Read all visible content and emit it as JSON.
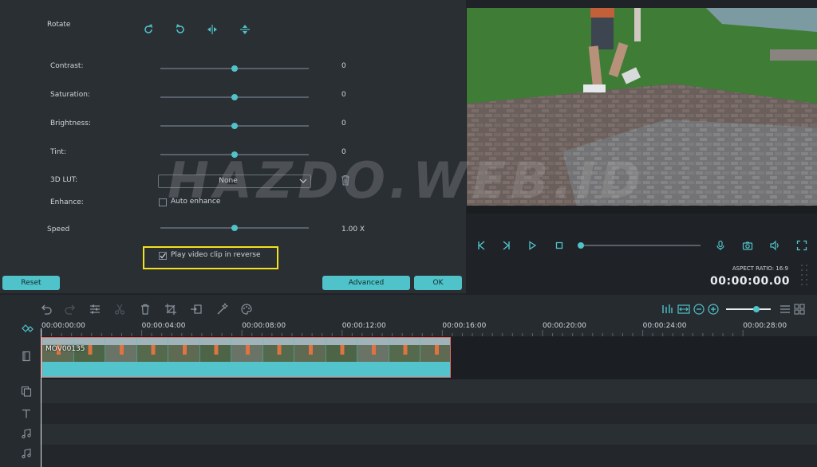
{
  "settings": {
    "rotate_label": "Rotate",
    "sliders": [
      {
        "label": "Contrast:",
        "value": "0",
        "level": 0.5
      },
      {
        "label": "Saturation:",
        "value": "0",
        "level": 0.5
      },
      {
        "label": "Brightness:",
        "value": "0",
        "level": 0.5
      },
      {
        "label": "Tint:",
        "value": "0",
        "level": 0.5
      }
    ],
    "lut_label": "3D LUT:",
    "lut_value": "None",
    "enhance_label": "Enhance:",
    "auto_enhance_label": "Auto enhance",
    "speed_label": "Speed",
    "speed_value": "1.00 X",
    "speed_level": 0.5,
    "reverse_label": "Play video clip in reverse",
    "reverse_checked": true,
    "reset_label": "Reset",
    "advanced_label": "Advanced",
    "ok_label": "OK"
  },
  "preview": {
    "aspect_ratio": "ASPECT RATIO: 16:9",
    "timecode": "00:00:00.00",
    "progress": 0.0
  },
  "timeline": {
    "ticks": [
      "00:00:00:00",
      "00:00:04:00",
      "00:00:08:00",
      "00:00:12:00",
      "00:00:16:00",
      "00:00:20:00",
      "00:00:24:00",
      "00:00:28:00"
    ],
    "clip_name": "MOV00135"
  },
  "watermark": "HAZDO.WEB.ID",
  "colors": {
    "accent": "#4fc3c9",
    "highlight": "#f5e21a",
    "clip_border": "#e06a6a"
  }
}
